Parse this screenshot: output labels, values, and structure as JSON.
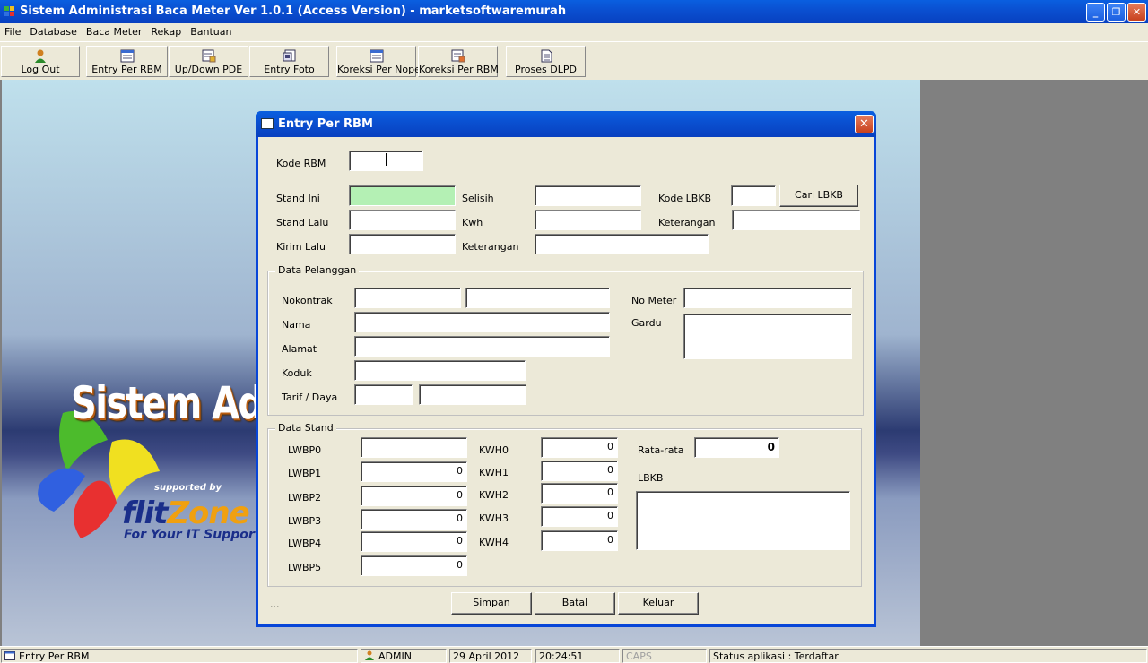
{
  "app": {
    "title": "Sistem Administrasi Baca Meter Ver 1.0.1 (Access Version)  -  marketsoftwaremurah"
  },
  "menu": [
    "File",
    "Database",
    "Baca Meter",
    "Rekap",
    "Bantuan"
  ],
  "toolbar": {
    "logout": "Log Out",
    "entry_rbm": "Entry Per RBM",
    "updown": "Up/Down PDE",
    "entry_foto": "Entry Foto",
    "koreksi_nopel": "Koreksi Per Nopel",
    "koreksi_rbm": "Koreksi Per RBM",
    "proses": "Proses DLPD"
  },
  "splash": {
    "title": "Sistem Admi",
    "supported": "supported by",
    "brand_a": "flit",
    "brand_b": "Zone",
    "tagline": "For Your IT Support"
  },
  "dialog": {
    "title": "Entry Per RBM",
    "kode_rbm": "Kode RBM",
    "stand_ini": "Stand Ini",
    "stand_lalu": "Stand Lalu",
    "kirim_lalu": "Kirim Lalu",
    "selisih": "Selisih",
    "kwh": "Kwh",
    "keterangan": "Keterangan",
    "kode_lbkb": "Kode LBKB",
    "cari_lbkb": "Cari LBKB",
    "keterangan2": "Keterangan",
    "pelanggan": {
      "caption": "Data Pelanggan",
      "nokontrak": "Nokontrak",
      "nama": "Nama",
      "alamat": "Alamat",
      "koduk": "Koduk",
      "tarif": "Tarif / Daya",
      "no_meter": "No Meter",
      "gardu": "Gardu"
    },
    "stand": {
      "caption": "Data Stand",
      "lwbp": [
        "LWBP0",
        "LWBP1",
        "LWBP2",
        "LWBP3",
        "LWBP4",
        "LWBP5"
      ],
      "lwbp_vals": [
        "",
        "0",
        "0",
        "0",
        "0",
        "0"
      ],
      "kwh": [
        "KWH0",
        "KWH1",
        "KWH2",
        "KWH3",
        "KWH4"
      ],
      "kwh_vals": [
        "0",
        "0",
        "0",
        "0",
        "0"
      ],
      "rata": "Rata-rata",
      "rata_val": "0",
      "lbkb": "LBKB"
    },
    "ellipsis": "...",
    "simpan": "Simpan",
    "batal": "Batal",
    "keluar": "Keluar"
  },
  "status": {
    "form": "Entry Per RBM",
    "user": "ADMIN",
    "date": "29 April 2012",
    "time": "20:24:51",
    "caps": "CAPS",
    "app_status": "Status aplikasi : Terdaftar"
  }
}
